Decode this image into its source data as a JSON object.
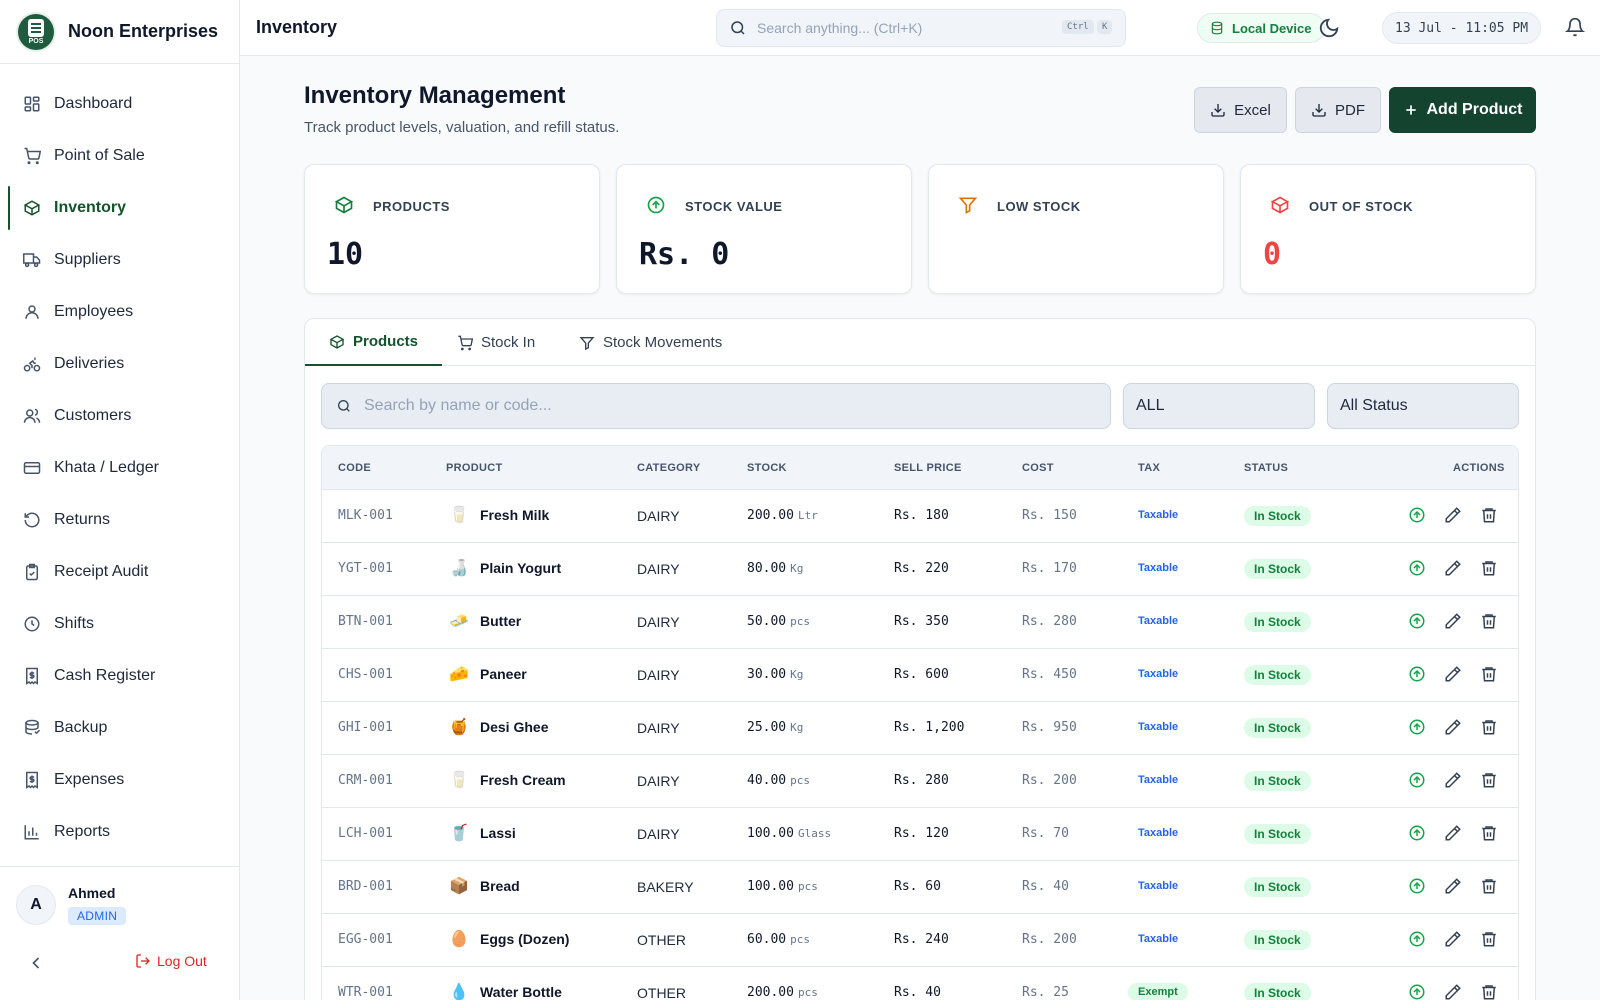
{
  "brand": {
    "name": "Noon Enterprises",
    "logo_text": "POS"
  },
  "sidebar": {
    "items": [
      {
        "label": "Dashboard",
        "icon": "grid-icon"
      },
      {
        "label": "Point of Sale",
        "icon": "cart-icon"
      },
      {
        "label": "Inventory",
        "icon": "box-icon",
        "active": true
      },
      {
        "label": "Suppliers",
        "icon": "truck-icon"
      },
      {
        "label": "Employees",
        "icon": "user-icon"
      },
      {
        "label": "Deliveries",
        "icon": "bike-icon"
      },
      {
        "label": "Customers",
        "icon": "users-icon"
      },
      {
        "label": "Khata / Ledger",
        "icon": "card-icon"
      },
      {
        "label": "Returns",
        "icon": "rotate-icon"
      },
      {
        "label": "Receipt Audit",
        "icon": "clipboard-check-icon"
      },
      {
        "label": "Shifts",
        "icon": "clock-icon"
      },
      {
        "label": "Cash Register",
        "icon": "receipt-dollar-icon"
      },
      {
        "label": "Backup",
        "icon": "database-icon"
      },
      {
        "label": "Expenses",
        "icon": "receipt-dollar-icon"
      },
      {
        "label": "Reports",
        "icon": "bar-chart-icon"
      }
    ]
  },
  "user": {
    "initial": "A",
    "name": "Ahmed",
    "role": "ADMIN",
    "logout": "Log Out"
  },
  "header": {
    "page": "Inventory",
    "search_placeholder": "Search anything... (Ctrl+K)",
    "kbd_ctrl": "Ctrl",
    "kbd_k": "K",
    "device": "Local Device",
    "datetime": "13 Jul - 11:05 PM"
  },
  "main": {
    "title": "Inventory Management",
    "subtitle": "Track product levels, valuation, and refill status.",
    "buttons": {
      "excel": "Excel",
      "pdf": "PDF",
      "add": "Add Product"
    }
  },
  "cards": [
    {
      "label": "PRODUCTS",
      "value": "10",
      "icon": "box-icon",
      "value_color": "#0f172a"
    },
    {
      "label": "STOCK VALUE",
      "value": "Rs. 0",
      "icon": "arrow-up-circle-icon",
      "value_color": "#0f172a"
    },
    {
      "label": "LOW STOCK",
      "value": "",
      "icon": "filter-icon",
      "value_color": "#0f172a"
    },
    {
      "label": "OUT OF STOCK",
      "value": "0",
      "icon": "box-icon",
      "value_color": "#ef4444"
    }
  ],
  "tabs": [
    "Products",
    "Stock In",
    "Stock Movements"
  ],
  "filters": {
    "search_placeholder": "Search by name or code...",
    "category": "ALL",
    "status": "All Status"
  },
  "table": {
    "columns": [
      "CODE",
      "PRODUCT",
      "CATEGORY",
      "STOCK",
      "SELL PRICE",
      "COST",
      "TAX",
      "STATUS",
      "ACTIONS"
    ],
    "rows": [
      {
        "code": "MLK-001",
        "emoji": "🥛",
        "name": "Fresh Milk",
        "category": "DAIRY",
        "stock": "200.00",
        "unit": "Ltr",
        "sell": "Rs. 180",
        "cost": "Rs. 150",
        "tax": "Taxable",
        "status": "In Stock"
      },
      {
        "code": "YGT-001",
        "emoji": "🍶",
        "name": "Plain Yogurt",
        "category": "DAIRY",
        "stock": "80.00",
        "unit": "Kg",
        "sell": "Rs. 220",
        "cost": "Rs. 170",
        "tax": "Taxable",
        "status": "In Stock"
      },
      {
        "code": "BTN-001",
        "emoji": "🧈",
        "name": "Butter",
        "category": "DAIRY",
        "stock": "50.00",
        "unit": "pcs",
        "sell": "Rs. 350",
        "cost": "Rs. 280",
        "tax": "Taxable",
        "status": "In Stock"
      },
      {
        "code": "CHS-001",
        "emoji": "🧀",
        "name": "Paneer",
        "category": "DAIRY",
        "stock": "30.00",
        "unit": "Kg",
        "sell": "Rs. 600",
        "cost": "Rs. 450",
        "tax": "Taxable",
        "status": "In Stock"
      },
      {
        "code": "GHI-001",
        "emoji": "🍯",
        "name": "Desi Ghee",
        "category": "DAIRY",
        "stock": "25.00",
        "unit": "Kg",
        "sell": "Rs. 1,200",
        "cost": "Rs. 950",
        "tax": "Taxable",
        "status": "In Stock"
      },
      {
        "code": "CRM-001",
        "emoji": "🥛",
        "name": "Fresh Cream",
        "category": "DAIRY",
        "stock": "40.00",
        "unit": "pcs",
        "sell": "Rs. 280",
        "cost": "Rs. 200",
        "tax": "Taxable",
        "status": "In Stock"
      },
      {
        "code": "LCH-001",
        "emoji": "🥤",
        "name": "Lassi",
        "category": "DAIRY",
        "stock": "100.00",
        "unit": "Glass",
        "sell": "Rs. 120",
        "cost": "Rs. 70",
        "tax": "Taxable",
        "status": "In Stock"
      },
      {
        "code": "BRD-001",
        "emoji": "📦",
        "name": "Bread",
        "category": "BAKERY",
        "stock": "100.00",
        "unit": "pcs",
        "sell": "Rs. 60",
        "cost": "Rs. 40",
        "tax": "Taxable",
        "status": "In Stock"
      },
      {
        "code": "EGG-001",
        "emoji": "🥚",
        "name": "Eggs (Dozen)",
        "category": "OTHER",
        "stock": "60.00",
        "unit": "pcs",
        "sell": "Rs. 240",
        "cost": "Rs. 200",
        "tax": "Taxable",
        "status": "In Stock"
      },
      {
        "code": "WTR-001",
        "emoji": "💧",
        "name": "Water Bottle",
        "category": "OTHER",
        "stock": "200.00",
        "unit": "pcs",
        "sell": "Rs. 40",
        "cost": "Rs. 25",
        "tax": "Exempt",
        "status": "In Stock"
      }
    ]
  },
  "colors": {
    "brand_dark": "#14432f",
    "accent": "#14532d",
    "success": "#15803d",
    "danger": "#ef4444",
    "link": "#2563eb"
  }
}
